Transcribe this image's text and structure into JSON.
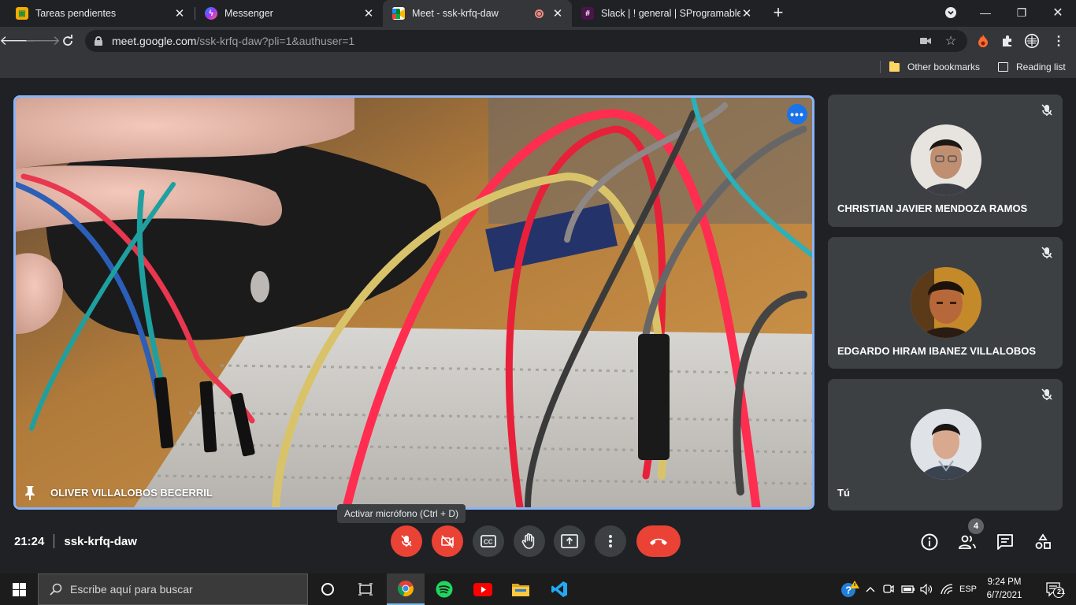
{
  "browser": {
    "tabs": [
      {
        "title": "Tareas pendientes",
        "favicon": "google-classroom-icon"
      },
      {
        "title": "Messenger",
        "favicon": "messenger-icon"
      },
      {
        "title": "Meet - ssk-krfq-daw",
        "favicon": "google-meet-icon",
        "active": true,
        "recording": true
      },
      {
        "title": "Slack | ! general | SProgramables",
        "favicon": "slack-icon"
      }
    ],
    "url_host": "meet.google.com",
    "url_path": "/ssk-krfq-daw?pli=1&authuser=1",
    "bookmarks": {
      "other": "Other bookmarks",
      "reading_list": "Reading list"
    }
  },
  "meet": {
    "main_participant": "OLIVER VILLALOBOS BECERRIL",
    "participants": [
      {
        "name": "CHRISTIAN JAVIER MENDOZA RAMOS",
        "muted": true
      },
      {
        "name": "EDGARDO HIRAM IBANEZ VILLALOBOS",
        "muted": true
      },
      {
        "name": "Tú",
        "muted": true
      }
    ],
    "tooltip": "Activar micrófono (Ctrl + D)",
    "time": "21:24",
    "meeting_code": "ssk-krfq-daw",
    "people_count": "4",
    "colors": {
      "accent": "#8ab4f8",
      "danger": "#ea4335",
      "tile": "#3c4043"
    }
  },
  "taskbar": {
    "search_placeholder": "Escribe aquí para buscar",
    "language": "ESP",
    "time": "9:24 PM",
    "date": "6/7/2021",
    "notifications": "21"
  }
}
